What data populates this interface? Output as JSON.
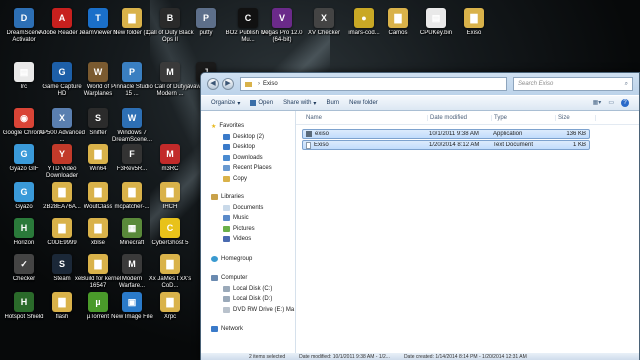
{
  "desktop": {
    "icons": [
      {
        "label": "DreamScene Activator",
        "glyph": "D",
        "color": "#2d6fb4"
      },
      {
        "label": "Adobe Reader XI",
        "glyph": "A",
        "color": "#c7201e"
      },
      {
        "label": "TeamViewer 9",
        "glyph": "T",
        "color": "#1a6fc9"
      },
      {
        "label": "New folder (2)",
        "glyph": "▇",
        "color": "#d9b24a"
      },
      {
        "label": "Call of Duty Black Ops II",
        "glyph": "B",
        "color": "#2a2a2a"
      },
      {
        "label": "putty",
        "glyph": "P",
        "color": "#5d6f8a"
      },
      {
        "label": "BO2 Publish Get Mu...",
        "glyph": "C",
        "color": "#111"
      },
      {
        "label": "Vegas Pro 12.0 (64-bit)",
        "glyph": "V",
        "color": "#6b2a8a"
      },
      {
        "label": "XV Checker",
        "glyph": "X",
        "color": "#444"
      },
      {
        "label": "imars-cod...",
        "glyph": "●",
        "color": "#c9a825"
      },
      {
        "label": "Camos",
        "glyph": "▇",
        "color": "#d9b24a"
      },
      {
        "label": "CPUKey.bin",
        "glyph": "▤",
        "color": "#e9e9e9"
      },
      {
        "label": "Exiso",
        "glyph": "▇",
        "color": "#d9b24a"
      },
      {
        "label": "lrc",
        "glyph": "▤",
        "color": "#e9e9e9"
      },
      {
        "label": "Game Capture HD",
        "glyph": "G",
        "color": "#1d5fa8"
      },
      {
        "label": "World of Warplanes",
        "glyph": "W",
        "color": "#7a5a30"
      },
      {
        "label": "Pinnacle Studio 15 ...",
        "glyph": "P",
        "color": "#3a7fc1"
      },
      {
        "label": "Call of Duty Modern ...",
        "glyph": "M",
        "color": "#3a3a3a"
      },
      {
        "label": "javaw 2014-01-3...",
        "glyph": "J",
        "color": "#1b1b1b"
      },
      {
        "label": "Google Chrome",
        "glyph": "◉",
        "color": "#d94436"
      },
      {
        "label": "XP500 Advanced ...",
        "glyph": "X",
        "color": "#5a7fb0"
      },
      {
        "label": "Sniffer",
        "glyph": "S",
        "color": "#2b2b2b"
      },
      {
        "label": "Windows 7 DreamScene...",
        "glyph": "W",
        "color": "#2d6fb4"
      },
      {
        "label": "Gyazo GIF",
        "glyph": "G",
        "color": "#3a9ad9"
      },
      {
        "label": "YTD Video Downloader",
        "glyph": "Y",
        "color": "#c23a2a"
      },
      {
        "label": "Win64",
        "glyph": "▇",
        "color": "#d9b24a"
      },
      {
        "label": "F3Rev5R...",
        "glyph": "F",
        "color": "#333"
      },
      {
        "label": "m3RC",
        "glyph": "M",
        "color": "#c22a2a"
      },
      {
        "label": "Gyazo",
        "glyph": "G",
        "color": "#3a9ad9"
      },
      {
        "label": "2B28EA76A...",
        "glyph": "▇",
        "color": "#d9b24a"
      },
      {
        "label": "WoutClass",
        "glyph": "▇",
        "color": "#d9b24a"
      },
      {
        "label": "mcpatcher-...",
        "glyph": "▇",
        "color": "#d9b24a"
      },
      {
        "label": "IHCH",
        "glyph": "▇",
        "color": "#d9b24a"
      },
      {
        "label": "Horizon",
        "glyph": "H",
        "color": "#2a7a3a"
      },
      {
        "label": "C0DE9999",
        "glyph": "▇",
        "color": "#d9b24a"
      },
      {
        "label": "xblse",
        "glyph": "▇",
        "color": "#d9b24a"
      },
      {
        "label": "Minecraft",
        "glyph": "▦",
        "color": "#5a8a3a"
      },
      {
        "label": "CyberGhost 5",
        "glyph": "C",
        "color": "#e8c21a"
      },
      {
        "label": "Checker",
        "glyph": "✓",
        "color": "#444"
      },
      {
        "label": "Steam",
        "glyph": "S",
        "color": "#1b2838"
      },
      {
        "label": "xeBuild for kernel 16547",
        "glyph": "▇",
        "color": "#d9b24a"
      },
      {
        "label": "Modern Warfare...",
        "glyph": "M",
        "color": "#3a3a3a"
      },
      {
        "label": "Xx JaMes t xX's CoD...",
        "glyph": "▇",
        "color": "#d9b24a"
      },
      {
        "label": "Hotspot Shield",
        "glyph": "H",
        "color": "#2a6a2a"
      },
      {
        "label": "flash",
        "glyph": "▇",
        "color": "#d9b24a"
      },
      {
        "label": "µTorrent",
        "glyph": "µ",
        "color": "#4a9a2a"
      },
      {
        "label": "New Image File",
        "glyph": "▣",
        "color": "#2a7ac9"
      },
      {
        "label": "Xrpc",
        "glyph": "▇",
        "color": "#d9b24a"
      }
    ]
  },
  "explorer": {
    "breadcrumb": [
      "Exiso"
    ],
    "search_placeholder": "Search Exiso",
    "toolbar": {
      "organize": "Organize",
      "open": "Open",
      "share_with": "Share with",
      "burn": "Burn",
      "new_folder": "New folder"
    },
    "nav": {
      "favorites": {
        "label": "Favorites",
        "items": [
          "Desktop (2)",
          "Desktop",
          "Downloads",
          "Recent Places",
          "Copy"
        ]
      },
      "libraries": {
        "label": "Libraries",
        "items": [
          "Documents",
          "Music",
          "Pictures",
          "Videos"
        ]
      },
      "homegroup": "Homegroup",
      "computer": {
        "label": "Computer",
        "items": [
          "Local Disk (C:)",
          "Local Disk (D:)",
          "DVD RW Drive (E:) Ma"
        ]
      },
      "network": "Network"
    },
    "columns": {
      "name": "Name",
      "date": "Date modified",
      "type": "Type",
      "size": "Size"
    },
    "files": [
      {
        "name": "exiso",
        "date": "10/1/2011 9:38 AM",
        "type": "Application",
        "size": "136 KB"
      },
      {
        "name": "Exiso",
        "date": "1/20/2014 8:12 AM",
        "type": "Text Document",
        "size": "1 KB"
      }
    ],
    "status": {
      "selected": "2 items selected",
      "date_modified": "Date modified: 10/1/2011 9:38 AM - 1/2...",
      "date_created": "Date created: 1/14/2014 8:14 PM - 1/20/2014 12:31 AM"
    }
  }
}
